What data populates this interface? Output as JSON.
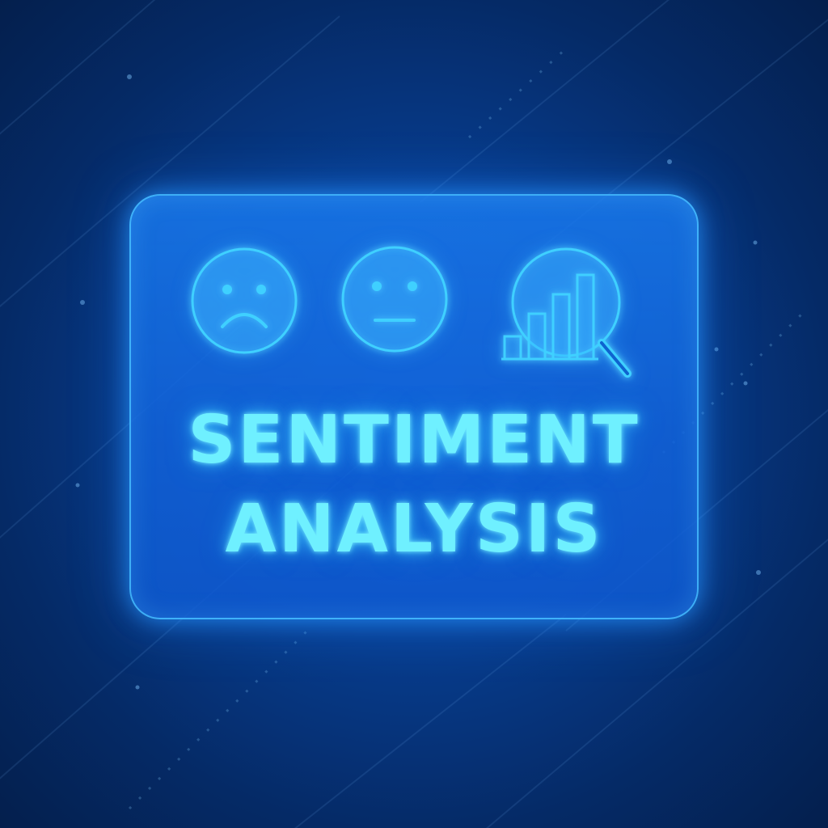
{
  "title": {
    "line1": "SENTIMENT",
    "line2": "ANALYSIS"
  },
  "icons": [
    "sad-face-icon",
    "neutral-face-icon",
    "chart-magnifier-icon"
  ],
  "colors": {
    "background_center": "#0a4fb0",
    "background_edge": "#041f4d",
    "panel": "#1878eb",
    "panel_border": "#46beff",
    "icon_stroke": "#3fd0ff",
    "text": "#6ff0ff"
  }
}
